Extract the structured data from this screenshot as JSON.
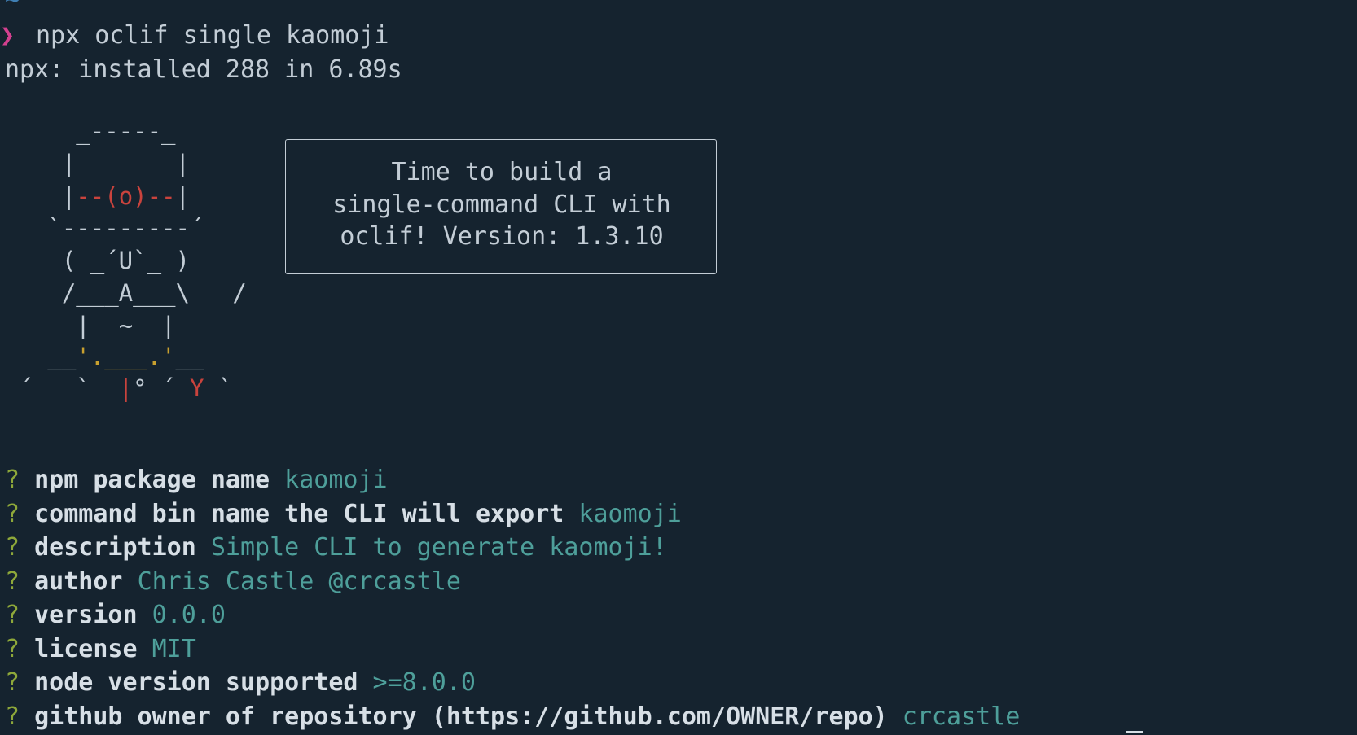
{
  "terminal": {
    "tilde": "~",
    "prompt_symbol": "❯",
    "command": "npx oclif single kaomoji",
    "install_output": "npx: installed 288 in 6.89s"
  },
  "ascii_art": {
    "line1": "     _-----_",
    "line2": "    |       |",
    "line3_left": "    |",
    "line3_mid": "--(o)--",
    "line3_right": "|",
    "line4": "   `---------´",
    "line5": "    ( _´U`_ )",
    "line6": "    /___A___\\   /",
    "line7_a": "     |  ",
    "line7_b": "~",
    "line7_c": "  |",
    "line8_a": "   __",
    "line8_b": "'.___.'",
    "line8_c": "__",
    "line9_a": " ´   `  ",
    "line9_b": "|",
    "line9_c": "° ´ ",
    "line9_d": "Y",
    "line9_e": " `"
  },
  "banner": {
    "line1": "Time to build a",
    "line2": "single-command CLI with",
    "line3": "oclif! Version: 1.3.10"
  },
  "questions": [
    {
      "mark": "?",
      "label": "npm package name",
      "answer": "kaomoji"
    },
    {
      "mark": "?",
      "label": "command bin name the CLI will export",
      "answer": "kaomoji"
    },
    {
      "mark": "?",
      "label": "description",
      "answer": "Simple CLI to generate kaomoji!"
    },
    {
      "mark": "?",
      "label": "author",
      "answer": "Chris Castle @crcastle"
    },
    {
      "mark": "?",
      "label": "version",
      "answer": "0.0.0"
    },
    {
      "mark": "?",
      "label": "license",
      "answer": "MIT"
    },
    {
      "mark": "?",
      "label": "node version supported",
      "answer": ">=8.0.0"
    },
    {
      "mark": "?",
      "label": "github owner of repository (https://github.com/OWNER/repo)",
      "answer": "crcastle"
    }
  ],
  "colors": {
    "background": "#15232f",
    "prompt": "#d3408f",
    "question_mark": "#8ea83a",
    "answer": "#4e9f9a",
    "robot_eye": "#c9433d",
    "robot_face": "#c8a02f"
  }
}
